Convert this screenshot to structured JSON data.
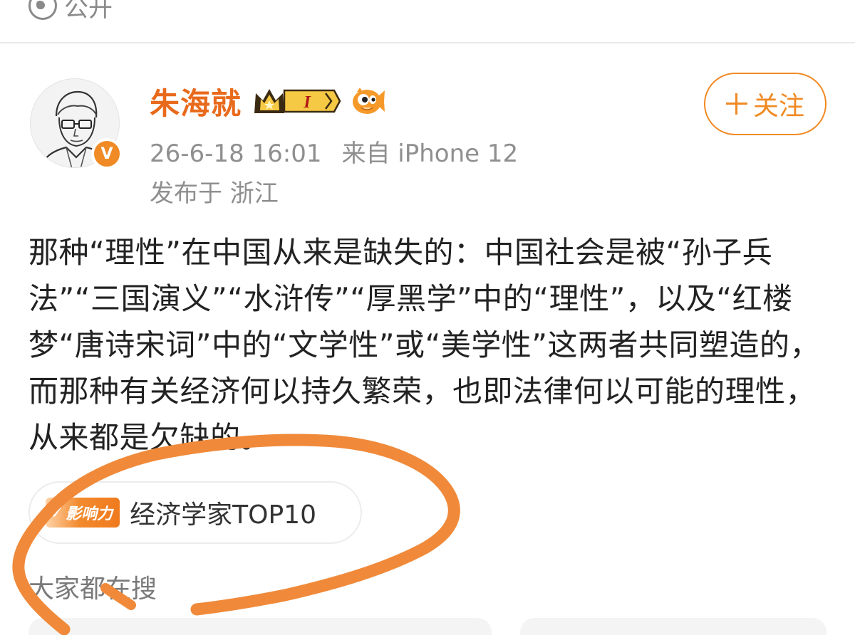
{
  "visibility": {
    "label": "公开",
    "icon": "globe-icon"
  },
  "author": {
    "name": "朱海就",
    "avatar": "avatar-image",
    "verified_icon": "verified-v-icon",
    "vip_badge_text": "I",
    "fan_icon": "fish-mascot-icon"
  },
  "meta": {
    "time": "26-6-18 16:01",
    "source": "来自 iPhone 12",
    "location": "发布于 浙江"
  },
  "follow_button": {
    "label": "关注",
    "icon": "plus-icon"
  },
  "post": {
    "text": "那种“理性”在中国从来是缺失的：中国社会是被“孙子兵法”“三国演义”“水浒传”“厚黑学”中的“理性”，以及“红楼梦“唐诗宋词”中的“文学性”或“美学性”这两者共同塑造的，而那种有关经济何以持久繁荣，也即法律何以可能的理性，从来都是欠缺的。"
  },
  "topic_chip": {
    "tag": "影响力",
    "label": "经济学家TOP10"
  },
  "search_section": {
    "heading": "大家都在搜"
  },
  "colors": {
    "accent": "#f08a24",
    "name": "#e86a1c",
    "meta": "#8f8f8f",
    "annotation": "#f08a3a"
  }
}
